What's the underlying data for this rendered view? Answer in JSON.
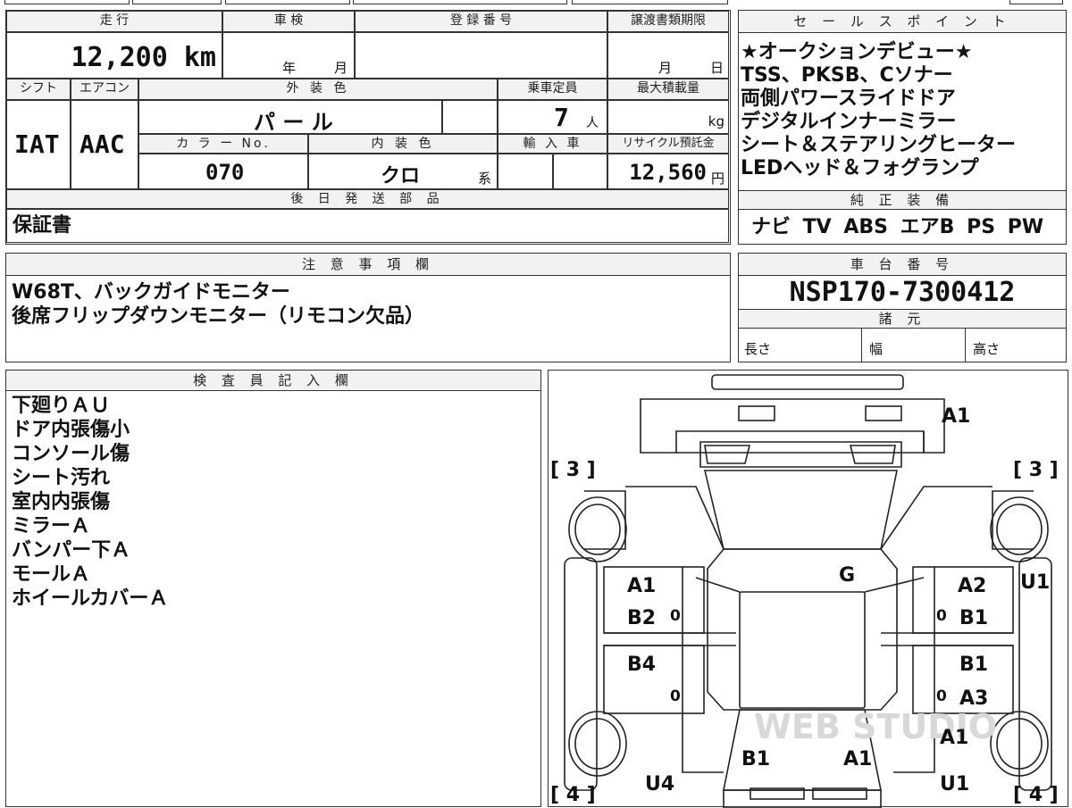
{
  "top_row": {
    "mileage_label": "走 行",
    "mileage_value": "12,200 km",
    "inspection_label": "車 検",
    "inspection_year": "年",
    "inspection_month": "月",
    "registration_label": "登 録 番 号",
    "transfer_label": "譲渡書類期限",
    "transfer_month": "月",
    "transfer_day": "日"
  },
  "row2": {
    "shift_label": "シフト",
    "shift_value": "IAT",
    "ac_label": "エアコン",
    "ac_value": "AAC",
    "exterior_label": "外 装 色",
    "exterior_value": "パ ー ル",
    "capacity_label": "乗車定員",
    "capacity_value": "7",
    "capacity_unit": "人",
    "maxload_label": "最大積載量",
    "maxload_unit": "kg",
    "color_no_label": "カ ラ ー No.",
    "color_no_value": "070",
    "interior_label": "内 装 色",
    "interior_value": "クロ",
    "interior_suffix": "系",
    "import_label": "輸 入 車",
    "recycle_label": "リサイクル預託金",
    "recycle_value": "12,560",
    "recycle_unit": "円"
  },
  "later_parts": {
    "label": "後 日 発 送 部 品",
    "value": "保証書"
  },
  "sales_points": {
    "label": "セ ー ル ス ポ イ ン ト",
    "lines": [
      "★オークションデビュー★",
      "TSS、PKSB、Cソナー",
      "両側パワースライドドア",
      "デジタルインナーミラー",
      "シート＆ステアリングヒーター",
      "LEDヘッド＆フォグランプ"
    ]
  },
  "genuine_equipment": {
    "label": "純 正 装 備",
    "value": "ナビ TV ABS エアB PS PW"
  },
  "notes": {
    "label": "注 意 事 項 欄",
    "lines": [
      "W68T、バックガイドモニター",
      "後席フリップダウンモニター（リモコン欠品）"
    ]
  },
  "chassis": {
    "label": "車 台 番 号",
    "value": "NSP170-7300412"
  },
  "specs": {
    "label": "諸 元",
    "length": "長さ",
    "width": "幅",
    "height": "高さ"
  },
  "inspector": {
    "label": "検 査 員 記 入 欄",
    "lines": [
      "下廻りＡＵ",
      "ドア内張傷小",
      "コンソール傷",
      "シート汚れ",
      "室内内張傷",
      "ミラーＡ",
      "バンパー下Ａ",
      "モールＡ",
      "ホイールカバーＡ"
    ]
  },
  "diagram": {
    "bracket_tl": "[ 3 ]",
    "bracket_tr": "[ 3 ]",
    "bracket_bl": "[ 4 ]",
    "bracket_br": "[ 4 ]",
    "marks": {
      "front_bumper": "A1",
      "windshield": "G",
      "front_left_door": "A1",
      "front_left_door_2": "B2",
      "rear_left_door": "B4",
      "front_right_door": "A2",
      "front_right_door_2": "B1",
      "rear_right_door": "B1",
      "rear_right_door_2": "A3",
      "right_side": "U1",
      "rear_right_quarter": "A1",
      "rear_left": "B1",
      "rear_right": "A1",
      "rear_left_wheel": "U4",
      "rear_right_wheel": "U1",
      "zero_1": "0",
      "zero_2": "0",
      "zero_3": "0",
      "zero_4": "0"
    },
    "watermark": "WEB STUDIO"
  }
}
